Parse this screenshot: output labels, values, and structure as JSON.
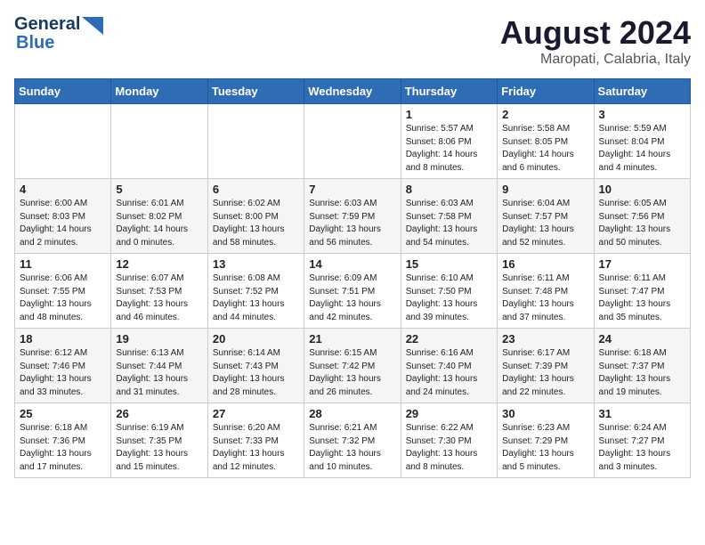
{
  "header": {
    "logo_general": "General",
    "logo_blue": "Blue",
    "main_title": "August 2024",
    "subtitle": "Maropati, Calabria, Italy"
  },
  "columns": [
    "Sunday",
    "Monday",
    "Tuesday",
    "Wednesday",
    "Thursday",
    "Friday",
    "Saturday"
  ],
  "weeks": [
    {
      "days": [
        {
          "num": "",
          "info": ""
        },
        {
          "num": "",
          "info": ""
        },
        {
          "num": "",
          "info": ""
        },
        {
          "num": "",
          "info": ""
        },
        {
          "num": "1",
          "info": "Sunrise: 5:57 AM\nSunset: 8:06 PM\nDaylight: 14 hours\nand 8 minutes."
        },
        {
          "num": "2",
          "info": "Sunrise: 5:58 AM\nSunset: 8:05 PM\nDaylight: 14 hours\nand 6 minutes."
        },
        {
          "num": "3",
          "info": "Sunrise: 5:59 AM\nSunset: 8:04 PM\nDaylight: 14 hours\nand 4 minutes."
        }
      ]
    },
    {
      "days": [
        {
          "num": "4",
          "info": "Sunrise: 6:00 AM\nSunset: 8:03 PM\nDaylight: 14 hours\nand 2 minutes."
        },
        {
          "num": "5",
          "info": "Sunrise: 6:01 AM\nSunset: 8:02 PM\nDaylight: 14 hours\nand 0 minutes."
        },
        {
          "num": "6",
          "info": "Sunrise: 6:02 AM\nSunset: 8:00 PM\nDaylight: 13 hours\nand 58 minutes."
        },
        {
          "num": "7",
          "info": "Sunrise: 6:03 AM\nSunset: 7:59 PM\nDaylight: 13 hours\nand 56 minutes."
        },
        {
          "num": "8",
          "info": "Sunrise: 6:03 AM\nSunset: 7:58 PM\nDaylight: 13 hours\nand 54 minutes."
        },
        {
          "num": "9",
          "info": "Sunrise: 6:04 AM\nSunset: 7:57 PM\nDaylight: 13 hours\nand 52 minutes."
        },
        {
          "num": "10",
          "info": "Sunrise: 6:05 AM\nSunset: 7:56 PM\nDaylight: 13 hours\nand 50 minutes."
        }
      ]
    },
    {
      "days": [
        {
          "num": "11",
          "info": "Sunrise: 6:06 AM\nSunset: 7:55 PM\nDaylight: 13 hours\nand 48 minutes."
        },
        {
          "num": "12",
          "info": "Sunrise: 6:07 AM\nSunset: 7:53 PM\nDaylight: 13 hours\nand 46 minutes."
        },
        {
          "num": "13",
          "info": "Sunrise: 6:08 AM\nSunset: 7:52 PM\nDaylight: 13 hours\nand 44 minutes."
        },
        {
          "num": "14",
          "info": "Sunrise: 6:09 AM\nSunset: 7:51 PM\nDaylight: 13 hours\nand 42 minutes."
        },
        {
          "num": "15",
          "info": "Sunrise: 6:10 AM\nSunset: 7:50 PM\nDaylight: 13 hours\nand 39 minutes."
        },
        {
          "num": "16",
          "info": "Sunrise: 6:11 AM\nSunset: 7:48 PM\nDaylight: 13 hours\nand 37 minutes."
        },
        {
          "num": "17",
          "info": "Sunrise: 6:11 AM\nSunset: 7:47 PM\nDaylight: 13 hours\nand 35 minutes."
        }
      ]
    },
    {
      "days": [
        {
          "num": "18",
          "info": "Sunrise: 6:12 AM\nSunset: 7:46 PM\nDaylight: 13 hours\nand 33 minutes."
        },
        {
          "num": "19",
          "info": "Sunrise: 6:13 AM\nSunset: 7:44 PM\nDaylight: 13 hours\nand 31 minutes."
        },
        {
          "num": "20",
          "info": "Sunrise: 6:14 AM\nSunset: 7:43 PM\nDaylight: 13 hours\nand 28 minutes."
        },
        {
          "num": "21",
          "info": "Sunrise: 6:15 AM\nSunset: 7:42 PM\nDaylight: 13 hours\nand 26 minutes."
        },
        {
          "num": "22",
          "info": "Sunrise: 6:16 AM\nSunset: 7:40 PM\nDaylight: 13 hours\nand 24 minutes."
        },
        {
          "num": "23",
          "info": "Sunrise: 6:17 AM\nSunset: 7:39 PM\nDaylight: 13 hours\nand 22 minutes."
        },
        {
          "num": "24",
          "info": "Sunrise: 6:18 AM\nSunset: 7:37 PM\nDaylight: 13 hours\nand 19 minutes."
        }
      ]
    },
    {
      "days": [
        {
          "num": "25",
          "info": "Sunrise: 6:18 AM\nSunset: 7:36 PM\nDaylight: 13 hours\nand 17 minutes."
        },
        {
          "num": "26",
          "info": "Sunrise: 6:19 AM\nSunset: 7:35 PM\nDaylight: 13 hours\nand 15 minutes."
        },
        {
          "num": "27",
          "info": "Sunrise: 6:20 AM\nSunset: 7:33 PM\nDaylight: 13 hours\nand 12 minutes."
        },
        {
          "num": "28",
          "info": "Sunrise: 6:21 AM\nSunset: 7:32 PM\nDaylight: 13 hours\nand 10 minutes."
        },
        {
          "num": "29",
          "info": "Sunrise: 6:22 AM\nSunset: 7:30 PM\nDaylight: 13 hours\nand 8 minutes."
        },
        {
          "num": "30",
          "info": "Sunrise: 6:23 AM\nSunset: 7:29 PM\nDaylight: 13 hours\nand 5 minutes."
        },
        {
          "num": "31",
          "info": "Sunrise: 6:24 AM\nSunset: 7:27 PM\nDaylight: 13 hours\nand 3 minutes."
        }
      ]
    }
  ]
}
